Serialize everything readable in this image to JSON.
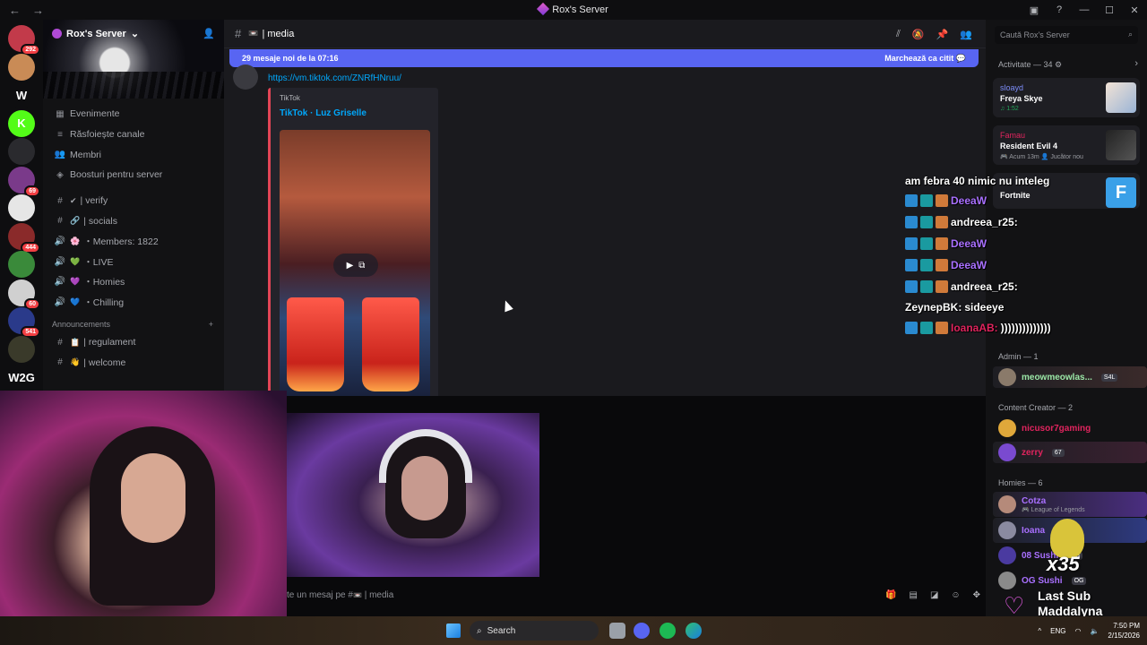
{
  "window": {
    "title": "Rox's Server",
    "back_glyph": "←",
    "forward_glyph": "→",
    "controls": [
      "▣",
      "?",
      "—",
      "☐",
      "✕"
    ]
  },
  "guilds": [
    {
      "label": "",
      "badge": "292",
      "color": "#c23a4a"
    },
    {
      "label": "",
      "badge": "",
      "color": "#c98b56"
    },
    {
      "label": "W",
      "badge": "",
      "color": "#0e0e10"
    },
    {
      "label": "K",
      "badge": "",
      "color": "#53fc18"
    },
    {
      "label": "",
      "badge": "",
      "color": "#2a2a2e"
    },
    {
      "label": "",
      "badge": "69",
      "color": "#7a3a8a"
    },
    {
      "label": "",
      "badge": "",
      "color": "#e6e6e6"
    },
    {
      "label": "",
      "badge": "444",
      "color": "#8a2a2a"
    },
    {
      "label": "",
      "badge": "",
      "color": "#3a8a3a"
    },
    {
      "label": "",
      "badge": "60",
      "color": "#d0d0d0"
    },
    {
      "label": "",
      "badge": "541",
      "color": "#2a3a8a"
    },
    {
      "label": "",
      "badge": "",
      "color": "#3a3a2a"
    },
    {
      "label": "W2G",
      "badge": "",
      "color": "#0e0e10"
    }
  ],
  "sidebar": {
    "server_name": "Rox's Server",
    "chevron": "⌄",
    "nav": [
      {
        "icon": "▦",
        "label": "Evenimente"
      },
      {
        "icon": "≡",
        "label": "Răsfoiește canale"
      },
      {
        "icon": "👥",
        "label": "Membri"
      },
      {
        "icon": "◈",
        "label": "Boosturi pentru server"
      }
    ],
    "channels": [
      {
        "icon": "#",
        "emoji": "✔",
        "label": "| verify"
      },
      {
        "icon": "#",
        "emoji": "🔗",
        "label": "| socials"
      },
      {
        "icon": "🔊",
        "emoji": "🌸",
        "label": "・Members: 1822"
      },
      {
        "icon": "🔊",
        "emoji": "💚",
        "label": "・LIVE"
      },
      {
        "icon": "🔊",
        "emoji": "💜",
        "label": "・Homies"
      },
      {
        "icon": "🔊",
        "emoji": "💙",
        "label": "・Chilling"
      }
    ],
    "category": "Announcements",
    "category_channels": [
      {
        "icon": "#",
        "emoji": "📋",
        "label": "| regulament"
      },
      {
        "icon": "#",
        "emoji": "👋",
        "label": "| welcome"
      }
    ]
  },
  "chat": {
    "channel_name": "| media",
    "channel_emoji": "📼",
    "new_messages": "29 mesaje noi de la 07:16",
    "mark_read": "Marchează ca citit",
    "link": "https://vm.tiktok.com/ZNRfHNruu/",
    "embed_provider": "TikTok",
    "embed_title": "TikTok · Luz Griselle",
    "composer_placeholder": "te un mesaj pe #",
    "composer_channel": "| media"
  },
  "header_icons": [
    "thread-icon",
    "mute-icon",
    "pin-icon",
    "members-icon"
  ],
  "search": {
    "placeholder": "Caută Rox's Server"
  },
  "overlay": [
    {
      "text": "am febra 40 nimic nu inteleg",
      "name": ""
    },
    {
      "text": "",
      "name": "DeeaW"
    },
    {
      "text": "",
      "name": "andreea_r25:"
    },
    {
      "text": "",
      "name": "DeeaW"
    },
    {
      "text": "",
      "name": "DeeaW"
    },
    {
      "text": "",
      "name": "andreea_r25:"
    },
    {
      "text": "sideeye",
      "name": "ZeynepBK:"
    },
    {
      "text": "))))))))))))))",
      "name": "IoanaAB:"
    }
  ],
  "members": {
    "activity_header": "Activitate — 34",
    "activities": [
      {
        "user": "sloayd",
        "title": "Freya Skye",
        "meta": "♫ 1:52",
        "color": "#b9a5d4"
      },
      {
        "user": "Famau",
        "title": "Resident Evil 4",
        "meta": "🎮 Acum 13m   👤 Jucător nou",
        "color": "#3a3a3a"
      }
    ],
    "fortnite": "Fortnite",
    "groups": [
      {
        "label": "Admin — 1",
        "members": [
          {
            "name": "meowmeowlas...",
            "tag": "S4L",
            "color": "#9ae6a6",
            "bg": "#3a2a2a"
          }
        ]
      },
      {
        "label": "Content Creator — 2",
        "members": [
          {
            "name": "nicusor7gaming",
            "tag": "",
            "color": "#e0245e",
            "bg": ""
          },
          {
            "name": "zerry",
            "tag": "67",
            "color": "#e0245e",
            "bg": "#3a2030"
          }
        ]
      },
      {
        "label": "Homies — 6",
        "members": [
          {
            "name": "Cotza",
            "sub": "🎮 League of Legends",
            "color": "#a970ff",
            "bg": "#4a2e80"
          },
          {
            "name": "Ioana",
            "sub": "",
            "color": "#a970ff",
            "bg": "#2e3a80"
          },
          {
            "name": "08 Sushi",
            "tag": "OG",
            "color": "#a970ff",
            "bg": ""
          },
          {
            "name": "OG Sushi",
            "tag": "OG",
            "color": "#a970ff",
            "bg": ""
          }
        ]
      }
    ]
  },
  "sub_alert": {
    "count": "x35",
    "title": "Last Sub",
    "name": "Maddalyna"
  },
  "taskbar": {
    "search": "Search",
    "lang": "ENG",
    "time": "7:50 PM",
    "date": "2/15/2026"
  }
}
